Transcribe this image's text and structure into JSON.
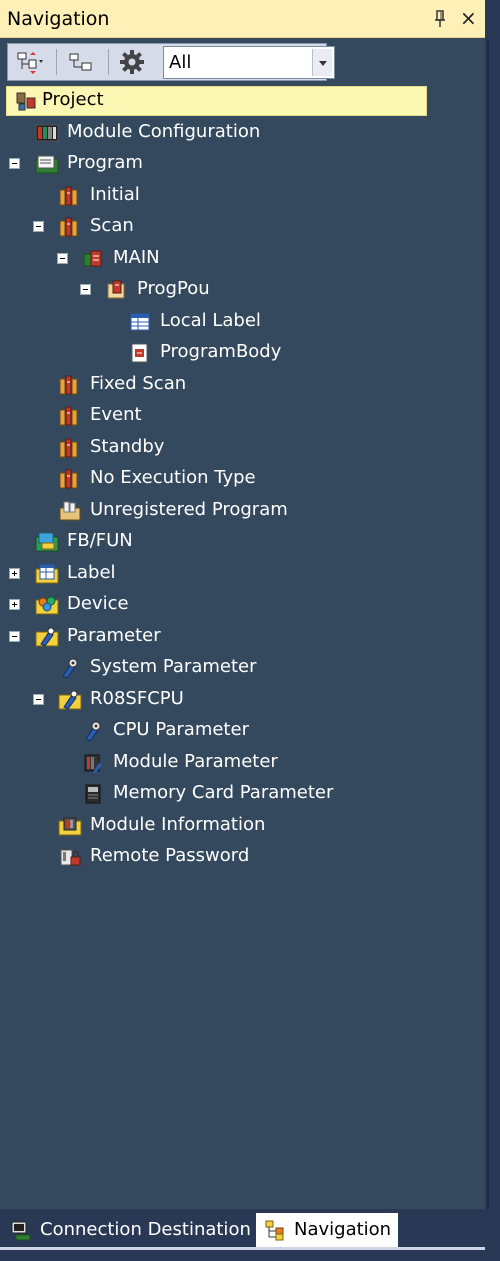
{
  "window": {
    "title": "Navigation",
    "pin_icon": "pin-icon",
    "close_glyph": "×"
  },
  "toolbar": {
    "buttons": [
      {
        "name": "expand-collapse-button",
        "icon": "tree-expand-icon"
      },
      {
        "name": "project-view-button",
        "icon": "tree-view-icon"
      },
      {
        "name": "settings-button",
        "icon": "gear-icon"
      }
    ],
    "filter": {
      "selected": "All"
    }
  },
  "tree": [
    {
      "label": "Project",
      "selected": true
    },
    {
      "label": "Module Configuration"
    },
    {
      "label": "Program",
      "expanded": true
    },
    {
      "label": "Initial"
    },
    {
      "label": "Scan",
      "expanded": true
    },
    {
      "label": "MAIN",
      "expanded": true
    },
    {
      "label": "ProgPou",
      "expanded": true
    },
    {
      "label": "Local Label"
    },
    {
      "label": "ProgramBody"
    },
    {
      "label": "Fixed Scan"
    },
    {
      "label": "Event"
    },
    {
      "label": "Standby"
    },
    {
      "label": "No Execution Type"
    },
    {
      "label": "Unregistered Program"
    },
    {
      "label": "FB/FUN"
    },
    {
      "label": "Label",
      "expanded": false
    },
    {
      "label": "Device",
      "expanded": false
    },
    {
      "label": "Parameter",
      "expanded": true
    },
    {
      "label": "System Parameter"
    },
    {
      "label": "R08SFCPU",
      "expanded": true
    },
    {
      "label": "CPU Parameter"
    },
    {
      "label": "Module Parameter"
    },
    {
      "label": "Memory Card Parameter"
    },
    {
      "label": "Module Information"
    },
    {
      "label": "Remote Password"
    }
  ],
  "tabs": [
    {
      "label": "Connection Destination",
      "active": false
    },
    {
      "label": "Navigation",
      "active": true
    }
  ],
  "colors": {
    "title_bg": "#fff0b8",
    "panel_bg": "#35495e",
    "selection_bg": "#fdf7b4"
  }
}
